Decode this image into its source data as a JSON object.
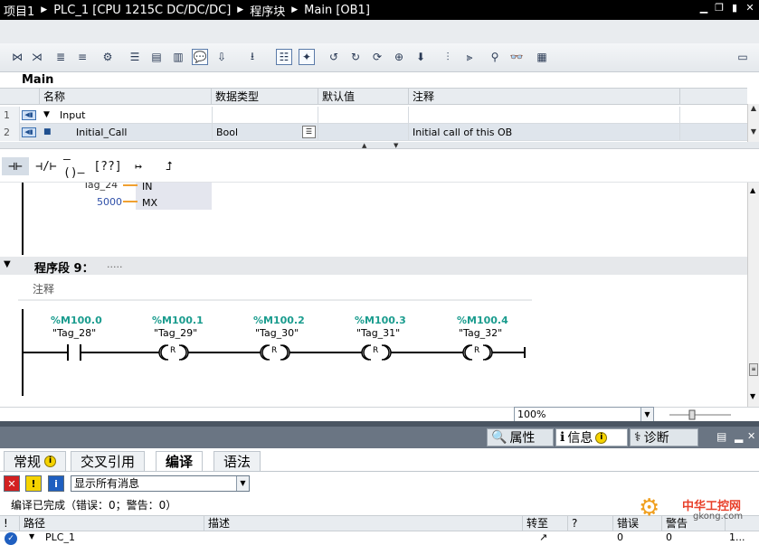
{
  "titlebar": {
    "crumbs": [
      "项目1",
      "PLC_1 [CPU 1215C DC/DC/DC]",
      "程序块",
      "Main [OB1]"
    ]
  },
  "block_name": "Main",
  "interface": {
    "columns": [
      "名称",
      "数据类型",
      "默认值",
      "注释"
    ],
    "rows": [
      {
        "num": "1",
        "name": "Input",
        "type": "",
        "default": "",
        "comment": ""
      },
      {
        "num": "2",
        "name": "Initial_Call",
        "type": "Bool",
        "default": "",
        "comment": "Initial call of this OB"
      }
    ]
  },
  "editor": {
    "prev_network": {
      "tag": "Tag_24",
      "value": "5000",
      "pin_in": "IN",
      "pin_mx": "MX"
    },
    "network": {
      "title": "程序段 9：",
      "dots": ".....",
      "comment": "注释",
      "elements": [
        {
          "address": "%M100.0",
          "tag": "\"Tag_28\""
        },
        {
          "address": "%M100.1",
          "tag": "\"Tag_29\""
        },
        {
          "address": "%M100.2",
          "tag": "\"Tag_30\""
        },
        {
          "address": "%M100.3",
          "tag": "\"Tag_31\""
        },
        {
          "address": "%M100.4",
          "tag": "\"Tag_32\""
        }
      ],
      "coil_letter": "R"
    }
  },
  "zoom": {
    "value": "100%"
  },
  "inspector": {
    "tabs": {
      "properties": "属性",
      "info": "信息",
      "diagnostics": "诊断"
    },
    "subtabs": {
      "general": "常规",
      "crossref": "交叉引用",
      "compile": "编译",
      "syntax": "语法"
    },
    "filter": "显示所有消息",
    "status": "编译已完成（错误：0；警告：0）",
    "columns": {
      "path": "路径",
      "desc": "描述",
      "goto": "转至",
      "q": "?",
      "errors": "错误",
      "warnings": "警告"
    },
    "row": {
      "path": "PLC_1",
      "errors": "0",
      "warnings": "0",
      "tail": "1..."
    }
  },
  "watermark": {
    "line1": "中华工控网",
    "line2": "gkong.com"
  }
}
